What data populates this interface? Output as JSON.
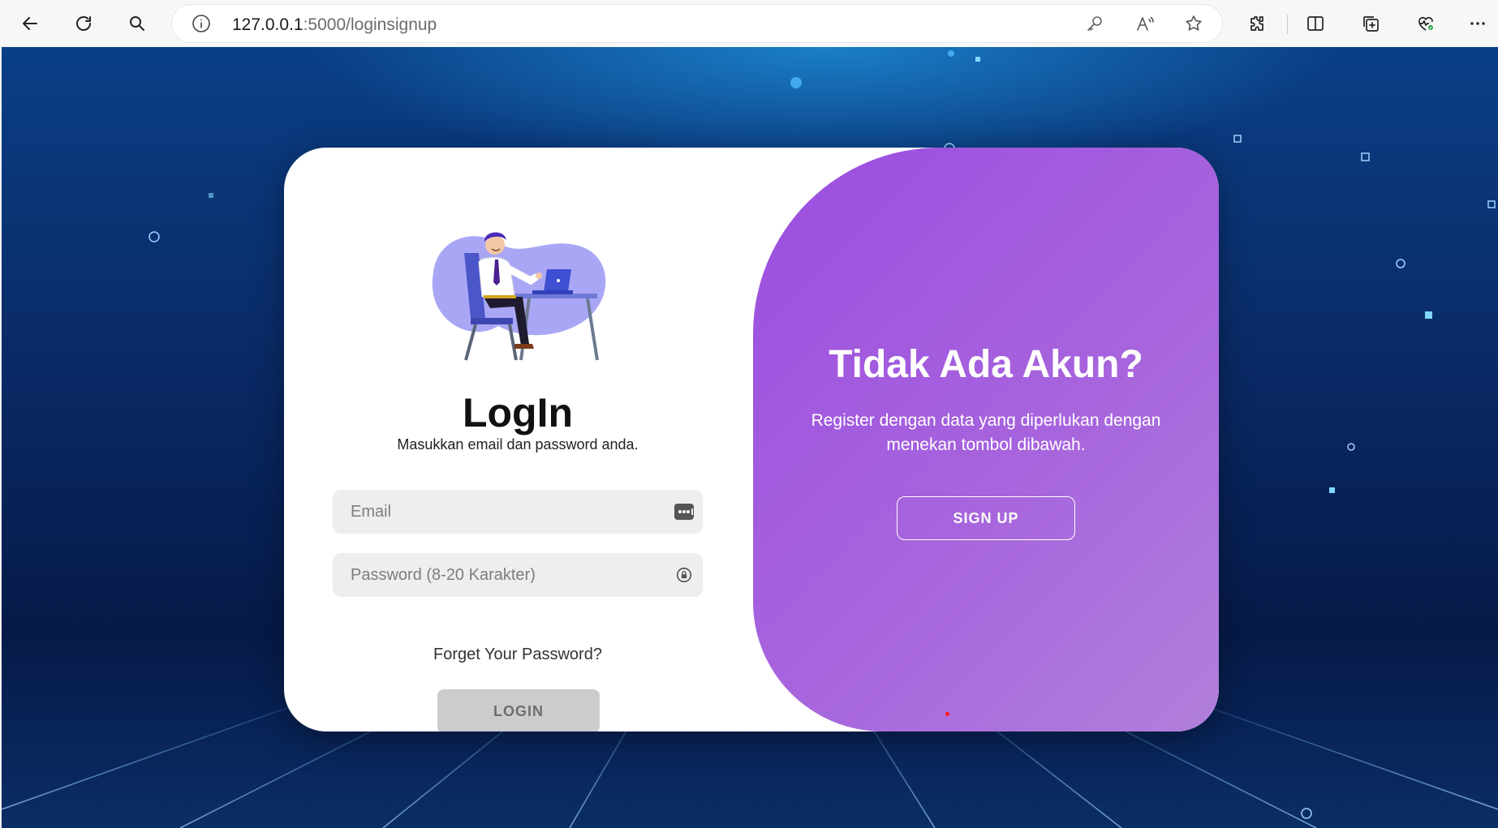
{
  "browser": {
    "url_host": "127.0.0.1",
    "url_rest": ":5000/loginsignup"
  },
  "login": {
    "title": "LogIn",
    "subtitle": "Masukkan email dan password anda.",
    "email_placeholder": "Email",
    "password_placeholder": "Password (8-20 Karakter)",
    "forgot_label": "Forget Your Password?",
    "login_button": "LOGIN"
  },
  "signup_panel": {
    "title": "Tidak Ada Akun?",
    "text": "Register dengan data yang diperlukan dengan menekan tombol dibawah.",
    "signup_button": "SIGN UP"
  },
  "colors": {
    "accent_purple": "#a35fde",
    "login_button_bg": "#cccccc",
    "background_navy": "#0a2a66"
  }
}
